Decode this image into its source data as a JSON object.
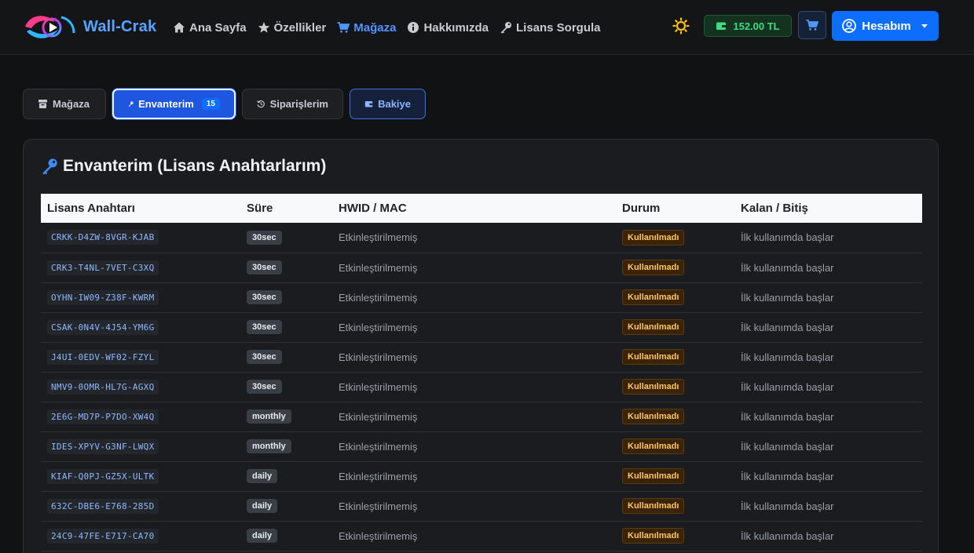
{
  "brand": {
    "name": "Wall-Crak"
  },
  "nav": {
    "links": [
      {
        "label": "Ana Sayfa",
        "icon": "home-icon"
      },
      {
        "label": "Özellikler",
        "icon": "star-icon"
      },
      {
        "label": "Mağaza",
        "icon": "cart-icon",
        "active": true
      },
      {
        "label": "Hakkımızda",
        "icon": "info-icon"
      },
      {
        "label": "Lisans Sorgula",
        "icon": "key-icon"
      }
    ],
    "balance": "152.00 TL",
    "account_label": "Hesabım"
  },
  "tabs": {
    "store": "Mağaza",
    "inventory": "Envanterim",
    "inventory_count": "15",
    "orders": "Siparişlerim",
    "balance": "Bakiye"
  },
  "card": {
    "title": "Envanterim (Lisans Anahtarlarım)"
  },
  "table": {
    "headers": {
      "key": "Lisans Anahtarı",
      "duration": "Süre",
      "hwid": "HWID / MAC",
      "status": "Durum",
      "remaining": "Kalan / Bitiş"
    },
    "rows": [
      {
        "key": "CRKK-D4ZW-8VGR-KJAB",
        "duration": "30sec",
        "hwid": "Etkinleştirilmemiş",
        "status": "Kullanılmadı",
        "remaining": "İlk kullanımda başlar"
      },
      {
        "key": "CRK3-T4NL-7VET-C3XQ",
        "duration": "30sec",
        "hwid": "Etkinleştirilmemiş",
        "status": "Kullanılmadı",
        "remaining": "İlk kullanımda başlar"
      },
      {
        "key": "OYHN-IW09-Z38F-KWRM",
        "duration": "30sec",
        "hwid": "Etkinleştirilmemiş",
        "status": "Kullanılmadı",
        "remaining": "İlk kullanımda başlar"
      },
      {
        "key": "CSAK-0N4V-4J54-YM6G",
        "duration": "30sec",
        "hwid": "Etkinleştirilmemiş",
        "status": "Kullanılmadı",
        "remaining": "İlk kullanımda başlar"
      },
      {
        "key": "J4UI-0EDV-WF02-FZYL",
        "duration": "30sec",
        "hwid": "Etkinleştirilmemiş",
        "status": "Kullanılmadı",
        "remaining": "İlk kullanımda başlar"
      },
      {
        "key": "NMV9-0OMR-HL7G-AGXQ",
        "duration": "30sec",
        "hwid": "Etkinleştirilmemiş",
        "status": "Kullanılmadı",
        "remaining": "İlk kullanımda başlar"
      },
      {
        "key": "2E6G-MD7P-P7DO-XW4Q",
        "duration": "monthly",
        "hwid": "Etkinleştirilmemiş",
        "status": "Kullanılmadı",
        "remaining": "İlk kullanımda başlar"
      },
      {
        "key": "IDES-XPYV-G3NF-LWQX",
        "duration": "monthly",
        "hwid": "Etkinleştirilmemiş",
        "status": "Kullanılmadı",
        "remaining": "İlk kullanımda başlar"
      },
      {
        "key": "KIAF-Q0PJ-GZ5X-ULTK",
        "duration": "daily",
        "hwid": "Etkinleştirilmemiş",
        "status": "Kullanılmadı",
        "remaining": "İlk kullanımda başlar"
      },
      {
        "key": "632C-DBE6-E768-285D",
        "duration": "daily",
        "hwid": "Etkinleştirilmemiş",
        "status": "Kullanılmadı",
        "remaining": "İlk kullanımda başlar"
      },
      {
        "key": "24C9-47FE-E717-CA70",
        "duration": "daily",
        "hwid": "Etkinleştirilmemiş",
        "status": "Kullanılmadı",
        "remaining": "İlk kullanımda başlar"
      }
    ]
  }
}
